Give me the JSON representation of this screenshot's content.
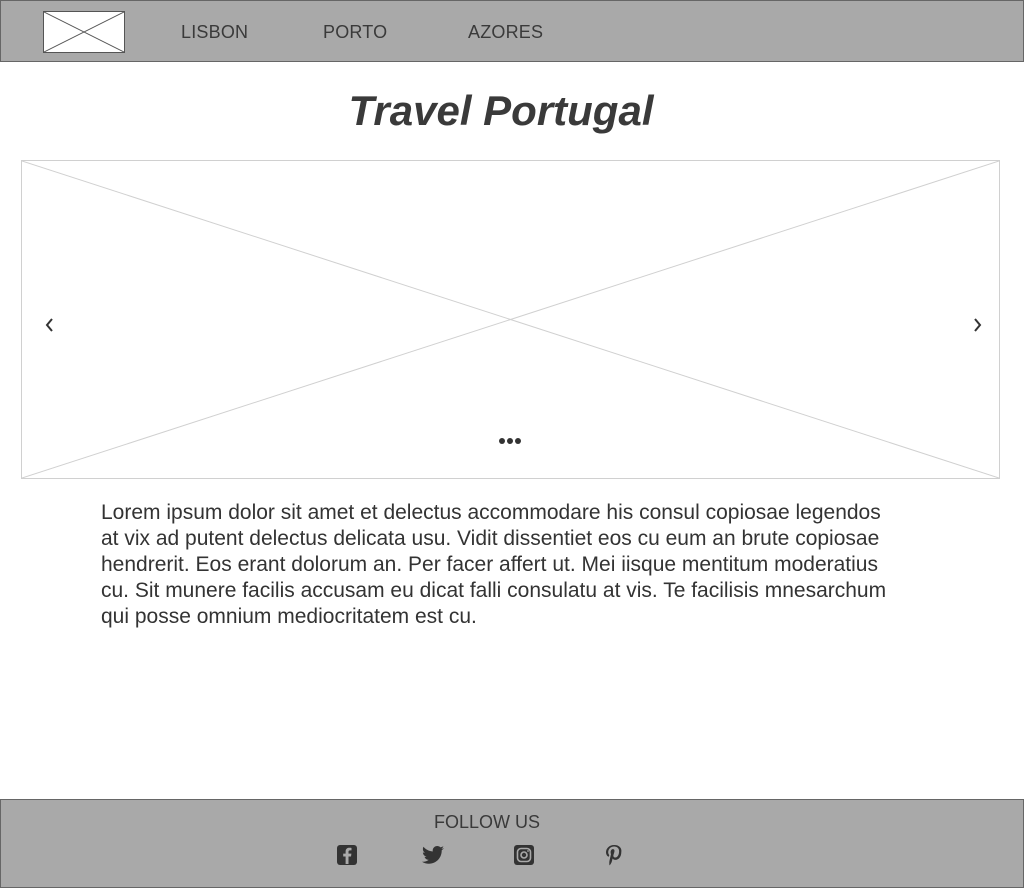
{
  "header": {
    "logo_icon": "image-placeholder-icon",
    "nav": [
      {
        "label": "LISBON"
      },
      {
        "label": "PORTO"
      },
      {
        "label": "AZORES"
      }
    ]
  },
  "main": {
    "title": "Travel Portugal",
    "carousel": {
      "prev_icon": "chevron-left-icon",
      "next_icon": "chevron-right-icon",
      "indicator_icon": "dots-icon"
    },
    "body": "Lorem ipsum dolor sit amet et delectus accommodare his consul copiosae legendos at vix ad putent delectus delicata usu. Vidit dissentiet eos cu eum an brute copiosae hendrerit. Eos erant dolorum an. Per facer affert ut. Mei iisque mentitum moderatius cu. Sit munere facilis accusam eu dicat falli consulatu at vis. Te facilisis mnesarchum qui posse omnium mediocritatem est cu."
  },
  "footer": {
    "follow_label": "FOLLOW US",
    "social": [
      {
        "icon": "facebook-icon"
      },
      {
        "icon": "twitter-icon"
      },
      {
        "icon": "instagram-icon"
      },
      {
        "icon": "pinterest-icon"
      }
    ]
  },
  "colors": {
    "bar_background": "#a9a9a9",
    "text": "#333333",
    "placeholder_line": "#d0d0d0"
  }
}
